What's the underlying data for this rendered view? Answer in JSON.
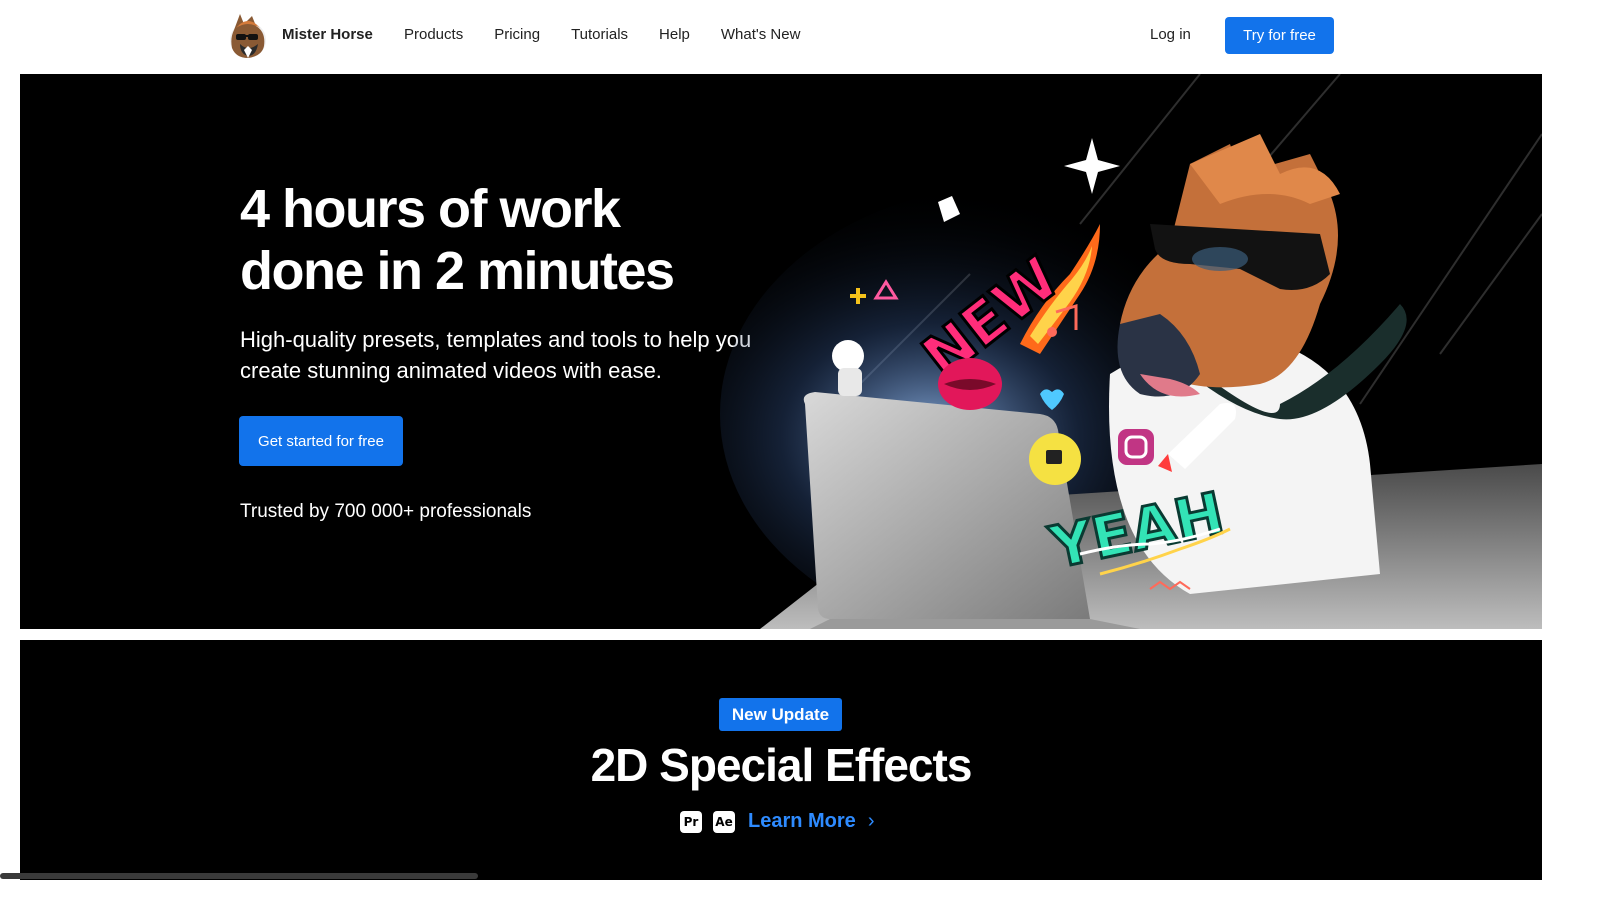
{
  "nav": {
    "brand": "Mister Horse",
    "links": [
      "Products",
      "Pricing",
      "Tutorials",
      "Help",
      "What's New"
    ],
    "login": "Log in",
    "try_button": "Try for free"
  },
  "hero": {
    "title_line1": "4 hours of work",
    "title_line2": "done in 2 minutes",
    "subtitle_line1": "High-quality presets, templates and tools to help you",
    "subtitle_line2": "create stunning animated videos with ease.",
    "cta": "Get started for free",
    "trust": "Trusted by 700 000+ professionals",
    "art_words": [
      "NEW",
      "YEAH"
    ]
  },
  "update": {
    "badge": "New Update",
    "headline": "2D Special Effects",
    "apps": [
      "Pr",
      "Ae"
    ],
    "learn_more": "Learn More",
    "chevron": "›"
  },
  "colors": {
    "accent": "#1273eb",
    "link": "#2e8bff",
    "hero_bg": "#000000",
    "new_pink": "#ff2d7a",
    "yeah_teal": "#33e3b6"
  }
}
